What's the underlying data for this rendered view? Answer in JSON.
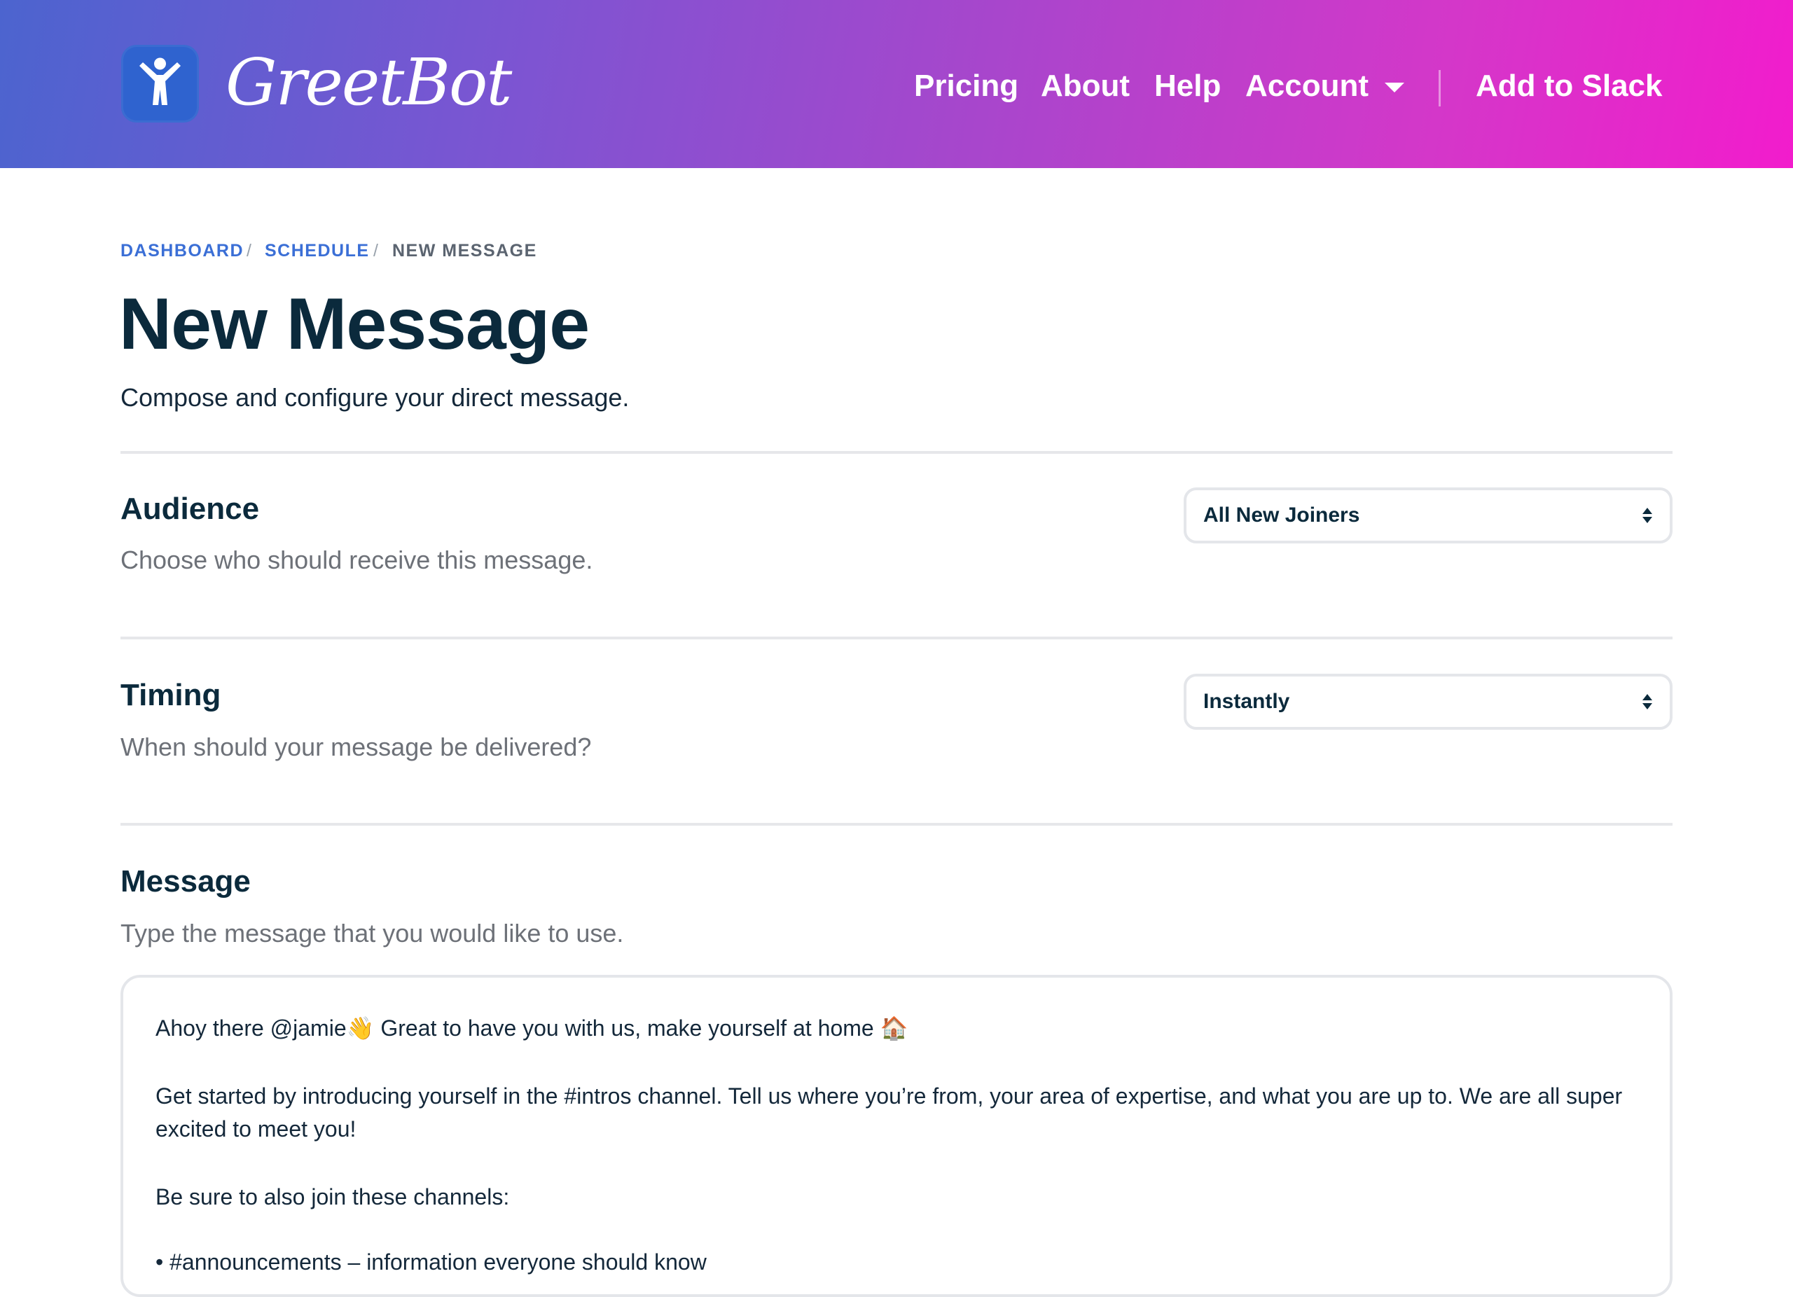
{
  "header": {
    "brand_name": "GreetBot",
    "nav": {
      "pricing": "Pricing",
      "about": "About",
      "help": "Help",
      "account": "Account",
      "add_to_slack": "Add to Slack"
    },
    "gradient_start": "#4c64cf",
    "gradient_end": "#f21ccc"
  },
  "breadcrumb": {
    "items": [
      "DASHBOARD",
      "SCHEDULE",
      "NEW MESSAGE"
    ],
    "separator": "/"
  },
  "page": {
    "title": "New Message",
    "subtitle": "Compose and configure your direct message."
  },
  "audience": {
    "title": "Audience",
    "description": "Choose who should receive this message.",
    "selected": "All New Joiners"
  },
  "timing": {
    "title": "Timing",
    "description": "When should your message be delivered?",
    "selected": "Instantly"
  },
  "message": {
    "title": "Message",
    "description": "Type the message that you would like to use.",
    "lines": [
      "Ahoy there @jamie👋 Great to have you with us, make yourself at home 🏠",
      "Get started by introducing yourself in the #intros channel. Tell us where you’re from, your area of expertise, and what you are up to. We are all super",
      "excited to meet you!",
      "Be sure to also join these channels:",
      "• #announcements – information everyone should know"
    ]
  },
  "colors": {
    "link": "#3b6fd6",
    "heading": "#0b2a3c",
    "muted": "#6d7178",
    "border": "#e4e6ea"
  },
  "icons": {
    "logo": "person-arms-up-icon",
    "account_caret": "caret-down-icon",
    "select_arrows": "up-down-arrows-icon"
  }
}
